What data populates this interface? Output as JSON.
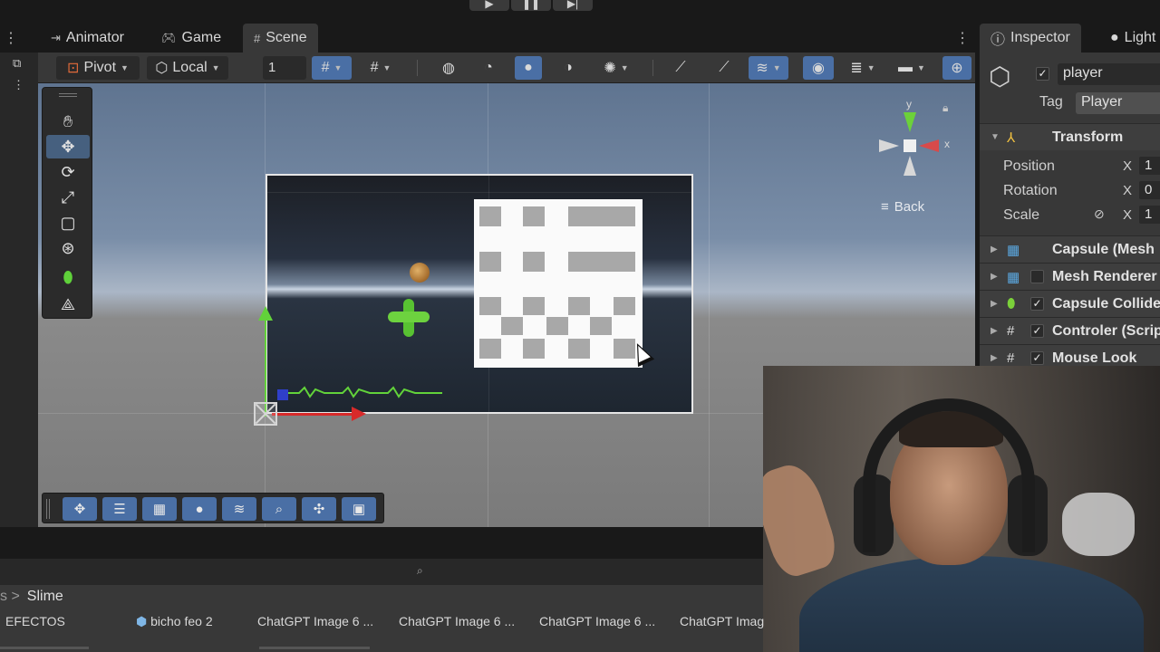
{
  "toolbar_top": {
    "play_icons": [
      "play-icon",
      "pause-icon",
      "step-icon"
    ]
  },
  "tabs": {
    "animator": "Animator",
    "game": "Game",
    "scene": "Scene"
  },
  "scene_toolbar": {
    "pivot": "Pivot",
    "local": "Local",
    "grid_value": "1"
  },
  "scene_view": {
    "back_label": "Back",
    "gizmo_y": "y",
    "gizmo_x": "x"
  },
  "inspector": {
    "tabs": {
      "inspector": "Inspector",
      "lighting": "Light"
    },
    "object_name": "player",
    "tag_label": "Tag",
    "tag_value": "Player",
    "transform": {
      "title": "Transform",
      "position_label": "Position",
      "rotation_label": "Rotation",
      "scale_label": "Scale",
      "axis_label": "X",
      "position_x": "1",
      "rotation_x": "0",
      "scale_x": "1"
    },
    "components": [
      {
        "name": "Capsule (Mesh",
        "icon": "mesh-filter-icon"
      },
      {
        "name": "Mesh Renderer",
        "icon": "mesh-renderer-icon"
      },
      {
        "name": "Capsule Collide",
        "icon": "capsule-collider-icon"
      },
      {
        "name": "Controler (Scrip",
        "icon": "script-icon"
      },
      {
        "name": "Mouse Look",
        "icon": "script-icon"
      }
    ]
  },
  "project": {
    "breadcrumb": "Slime",
    "files": [
      "EFECTOS",
      "bicho feo 2",
      "ChatGPT Image 6 ...",
      "ChatGPT Image 6 ...",
      "ChatGPT Image 6 ...",
      "ChatGPT Imag"
    ]
  },
  "colors": {
    "accent_blue": "#4a6fa5",
    "panel": "#383838",
    "background": "#191919",
    "axis_red": "#d82a2a",
    "axis_green": "#62d23a"
  }
}
